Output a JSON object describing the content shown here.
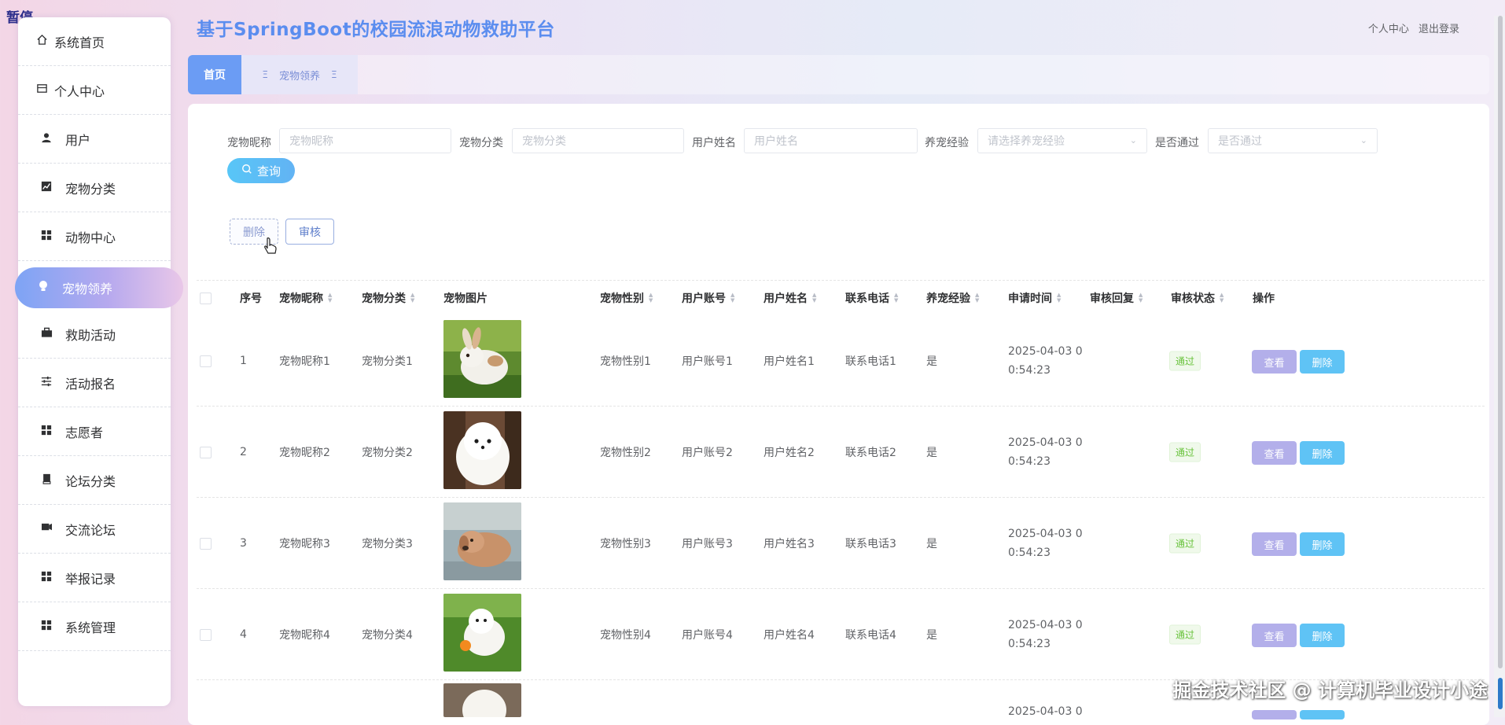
{
  "overlay": {
    "pause_label": "暂停"
  },
  "header": {
    "title": "基于SpringBoot的校园流浪动物救助平台",
    "personal_center": "个人中心",
    "logout": "退出登录"
  },
  "sidebar": {
    "items": [
      {
        "label": "系统首页",
        "icon": "home-icon"
      },
      {
        "label": "个人中心",
        "icon": "profile-icon"
      },
      {
        "label": "用户",
        "icon": "user-icon"
      },
      {
        "label": "宠物分类",
        "icon": "chart-icon"
      },
      {
        "label": "动物中心",
        "icon": "grid-icon"
      },
      {
        "label": "宠物领养",
        "icon": "bulb-icon"
      },
      {
        "label": "救助活动",
        "icon": "briefcase-icon"
      },
      {
        "label": "活动报名",
        "icon": "sliders-icon"
      },
      {
        "label": "志愿者",
        "icon": "grid-icon"
      },
      {
        "label": "论坛分类",
        "icon": "book-icon"
      },
      {
        "label": "交流论坛",
        "icon": "chat-icon"
      },
      {
        "label": "举报记录",
        "icon": "grid-icon"
      },
      {
        "label": "系统管理",
        "icon": "grid-icon"
      }
    ],
    "active_index": 5
  },
  "tabs": {
    "home": "首页",
    "current": "宠物领养"
  },
  "filters": {
    "pet_nickname": {
      "label": "宠物昵称",
      "placeholder": "宠物昵称"
    },
    "pet_category": {
      "label": "宠物分类",
      "placeholder": "宠物分类"
    },
    "user_name": {
      "label": "用户姓名",
      "placeholder": "用户姓名"
    },
    "experience": {
      "label": "养宠经验",
      "placeholder": "请选择养宠经验"
    },
    "approved": {
      "label": "是否通过",
      "placeholder": "是否通过"
    },
    "query_button": "查询"
  },
  "actions": {
    "delete": "删除",
    "audit": "审核"
  },
  "table": {
    "headers": [
      "序号",
      "宠物昵称",
      "宠物分类",
      "宠物图片",
      "宠物性别",
      "用户账号",
      "用户姓名",
      "联系电话",
      "养宠经验",
      "申请时间",
      "审核回复",
      "审核状态",
      "操作"
    ],
    "rows": [
      {
        "index": "1",
        "nickname": "宠物昵称1",
        "category": "宠物分类1",
        "image": "white-rabbit",
        "gender": "宠物性别1",
        "account": "用户账号1",
        "name": "用户姓名1",
        "phone": "联系电话1",
        "experience": "是",
        "time_line1": "2025-04-03 0",
        "time_line2": "0:54:23",
        "reply": "",
        "status": "通过",
        "view": "查看",
        "delete": "删除"
      },
      {
        "index": "2",
        "nickname": "宠物昵称2",
        "category": "宠物分类2",
        "image": "white-pomeranian",
        "gender": "宠物性别2",
        "account": "用户账号2",
        "name": "用户姓名2",
        "phone": "联系电话2",
        "experience": "是",
        "time_line1": "2025-04-03 0",
        "time_line2": "0:54:23",
        "reply": "",
        "status": "通过",
        "view": "查看",
        "delete": "删除"
      },
      {
        "index": "3",
        "nickname": "宠物昵称3",
        "category": "宠物分类3",
        "image": "tan-puppy",
        "gender": "宠物性别3",
        "account": "用户账号3",
        "name": "用户姓名3",
        "phone": "联系电话3",
        "experience": "是",
        "time_line1": "2025-04-03 0",
        "time_line2": "0:54:23",
        "reply": "",
        "status": "通过",
        "view": "查看",
        "delete": "删除"
      },
      {
        "index": "4",
        "nickname": "宠物昵称4",
        "category": "宠物分类4",
        "image": "white-dog-on-grass",
        "gender": "宠物性别4",
        "account": "用户账号4",
        "name": "用户姓名4",
        "phone": "联系电话4",
        "experience": "是",
        "time_line1": "2025-04-03 0",
        "time_line2": "0:54:23",
        "reply": "",
        "status": "通过",
        "view": "查看",
        "delete": "删除"
      },
      {
        "index": "",
        "nickname": "",
        "category": "",
        "image": "white-puppy",
        "gender": "",
        "account": "",
        "name": "",
        "phone": "",
        "experience": "",
        "time_line1": "2025-04-03 0",
        "time_line2": "",
        "reply": "",
        "status": "",
        "view": "",
        "delete": ""
      }
    ]
  },
  "watermark": "掘金技术社区 @ 计算机毕业设计小途",
  "colors": {
    "accent": "#5b8def",
    "active_gradient_start": "#7da4f5",
    "status_green": "#67c23a",
    "view_button": "#b3afea",
    "delete_button": "#5fc3f5"
  }
}
